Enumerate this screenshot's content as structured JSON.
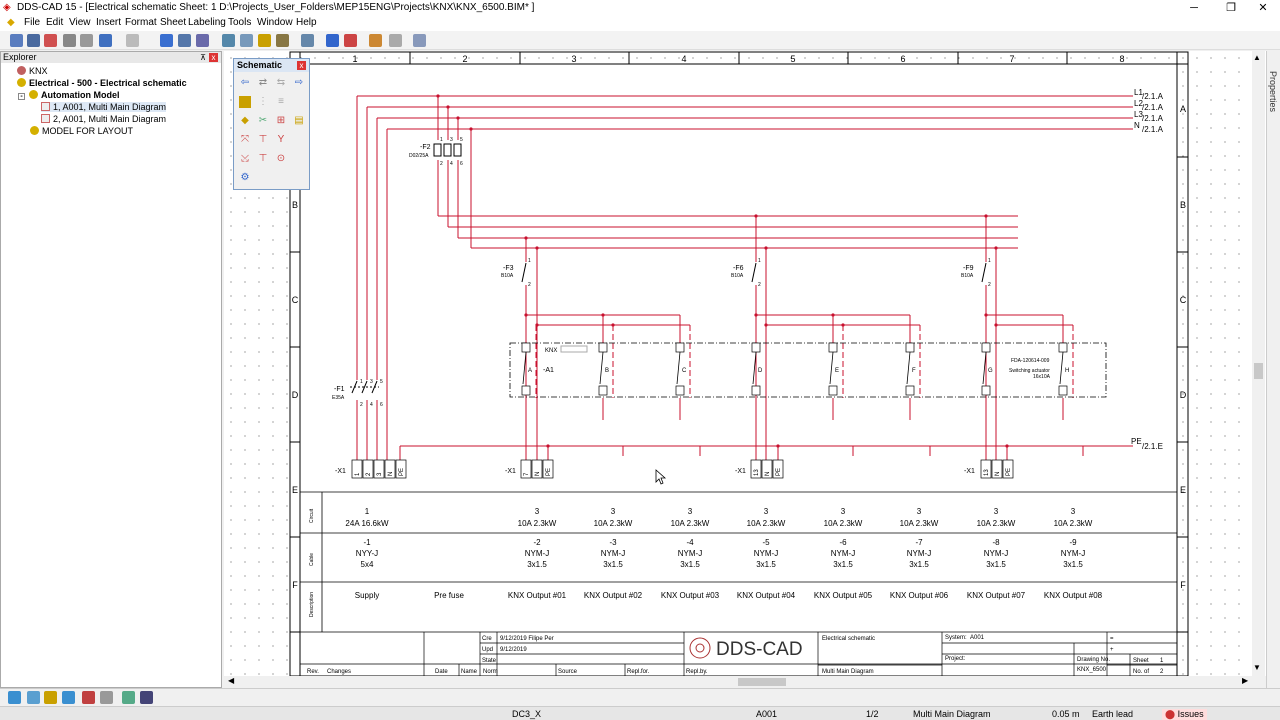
{
  "window": {
    "title": "DDS-CAD 15 - [Electrical schematic  Sheet: 1  D:\\Projects_User_Folders\\MEP15ENG\\Projects\\KNX\\KNX_6500.BIM* ]",
    "minimize": "─",
    "restore": "❐",
    "close": "✕"
  },
  "menu": [
    "File",
    "Edit",
    "View",
    "Insert",
    "Format",
    "Sheet",
    "Labeling",
    "Tools",
    "Window",
    "Help"
  ],
  "explorer": {
    "title": "Explorer",
    "pin": "⊼",
    "close": "x",
    "tree": [
      {
        "label": "KNX",
        "bold": false
      },
      {
        "label": "Electrical - 500 - Electrical schematic",
        "bold": true
      },
      {
        "label": "Automation Model",
        "bold": true
      },
      {
        "label": "1, A001, Multi Main Diagram",
        "bold": false,
        "selected": true
      },
      {
        "label": "2, A001, Multi Main Diagram",
        "bold": false
      },
      {
        "label": "MODEL FOR LAYOUT",
        "bold": false
      }
    ]
  },
  "schematic_palette": {
    "title": "Schematic",
    "close": "x"
  },
  "properties_tab": "Properties",
  "drawing": {
    "columns": [
      "1",
      "2",
      "3",
      "4",
      "5",
      "6",
      "7",
      "8"
    ],
    "rows": [
      "A",
      "B",
      "C",
      "D",
      "E",
      "F"
    ],
    "bus_labels": [
      "L1",
      "L2",
      "L3",
      "N"
    ],
    "bus_refs": [
      "/2.1.A",
      "/2.1.A",
      "/2.1.A",
      "/2.1.A"
    ],
    "pe_label": "PE",
    "pe_ref": "/2.1.E",
    "f2": {
      "tag": "-F2",
      "rating": "D02/25A",
      "top": [
        "1",
        "3",
        "5"
      ],
      "bottom": [
        "2",
        "4",
        "6"
      ]
    },
    "f1": {
      "tag": "-F1",
      "rating": "E35A",
      "top": [
        "1",
        "3",
        "5"
      ],
      "bottom": [
        "2",
        "4",
        "6"
      ]
    },
    "mcbs": [
      {
        "tag": "-F3",
        "rating": "B10A",
        "top": "1",
        "bottom": "2"
      },
      {
        "tag": "-F6",
        "rating": "B10A",
        "top": "1",
        "bottom": "2"
      },
      {
        "tag": "-F9",
        "rating": "B10A",
        "top": "1",
        "bottom": "2"
      }
    ],
    "actuator": {
      "tag": "-A1",
      "knx": "KNX",
      "model": "FDA-120614-009",
      "name": "Switching actuator",
      "spec": "16x10A",
      "channels": [
        "A",
        "B",
        "C",
        "D",
        "E",
        "F",
        "G",
        "H"
      ]
    },
    "terminals": {
      "tag": "-X1",
      "supply": [
        "1",
        "2",
        "3",
        "N",
        "PE"
      ],
      "out1": [
        "7",
        "N",
        "PE"
      ],
      "out2": [
        "13",
        "N",
        "PE"
      ],
      "out3": [
        "13",
        "N",
        "PE"
      ]
    },
    "table": {
      "row_labels": [
        "Circuit",
        "Cable",
        "Description"
      ],
      "circuits": [
        {
          "phase": "1",
          "rating": "24A",
          "power": "16.6kW",
          "cable_id": "-1",
          "cable_type": "NYY-J",
          "cable_size": "5x4",
          "desc": "Supply"
        },
        {
          "phase": "",
          "rating": "",
          "power": "",
          "cable_id": "",
          "cable_type": "",
          "cable_size": "",
          "desc": "Pre fuse"
        },
        {
          "phase": "3",
          "rating": "10A",
          "power": "2.3kW",
          "cable_id": "-2",
          "cable_type": "NYM-J",
          "cable_size": "3x1.5",
          "desc": "KNX Output #01"
        },
        {
          "phase": "3",
          "rating": "10A",
          "power": "2.3kW",
          "cable_id": "-3",
          "cable_type": "NYM-J",
          "cable_size": "3x1.5",
          "desc": "KNX Output #02"
        },
        {
          "phase": "3",
          "rating": "10A",
          "power": "2.3kW",
          "cable_id": "-4",
          "cable_type": "NYM-J",
          "cable_size": "3x1.5",
          "desc": "KNX Output #03"
        },
        {
          "phase": "3",
          "rating": "10A",
          "power": "2.3kW",
          "cable_id": "-5",
          "cable_type": "NYM-J",
          "cable_size": "3x1.5",
          "desc": "KNX Output #04"
        },
        {
          "phase": "3",
          "rating": "10A",
          "power": "2.3kW",
          "cable_id": "-6",
          "cable_type": "NYM-J",
          "cable_size": "3x1.5",
          "desc": "KNX Output #05"
        },
        {
          "phase": "3",
          "rating": "10A",
          "power": "2.3kW",
          "cable_id": "-7",
          "cable_type": "NYM-J",
          "cable_size": "3x1.5",
          "desc": "KNX Output #06"
        },
        {
          "phase": "3",
          "rating": "10A",
          "power": "2.3kW",
          "cable_id": "-8",
          "cable_type": "NYM-J",
          "cable_size": "3x1.5",
          "desc": "KNX Output #07"
        },
        {
          "phase": "3",
          "rating": "10A",
          "power": "2.3kW",
          "cable_id": "-9",
          "cable_type": "NYM-J",
          "cable_size": "3x1.5",
          "desc": "KNX Output #08"
        }
      ]
    },
    "title_block": {
      "cre_label": "Cre",
      "cre_value": "9/12/2019  Filipe Per",
      "upd_label": "Upd",
      "upd_value": "9/12/2019",
      "state_label": "State",
      "rev_label": "Rev.",
      "changes_label": "Changes",
      "date_label": "Date",
      "name_label": "Name",
      "norm_label": "Norm",
      "source_label": "Source",
      "replfor_label": "Repl.for.",
      "replby_label": "Repl.by.",
      "logo_text": "DDS-CAD",
      "doc_title": "Electrical schematic",
      "doc_sub": "Multi Main Diagram",
      "system_label": "System:",
      "system_value": "A001",
      "project_label": "Project:",
      "drawing_no_label": "Drawing No.",
      "drawing_no_value": "KNX_6500",
      "sheet_label": "Sheet",
      "sheet_value": "1",
      "noof_label": "No. of",
      "noof_value": "2",
      "eq": "=",
      "plus": "+"
    }
  },
  "status": {
    "layer": "DC3_X",
    "system": "A001",
    "sheet": "1/2",
    "view": "Multi Main Diagram",
    "size": "0.05 m",
    "layer2": "Earth lead",
    "issues": "Issues"
  }
}
